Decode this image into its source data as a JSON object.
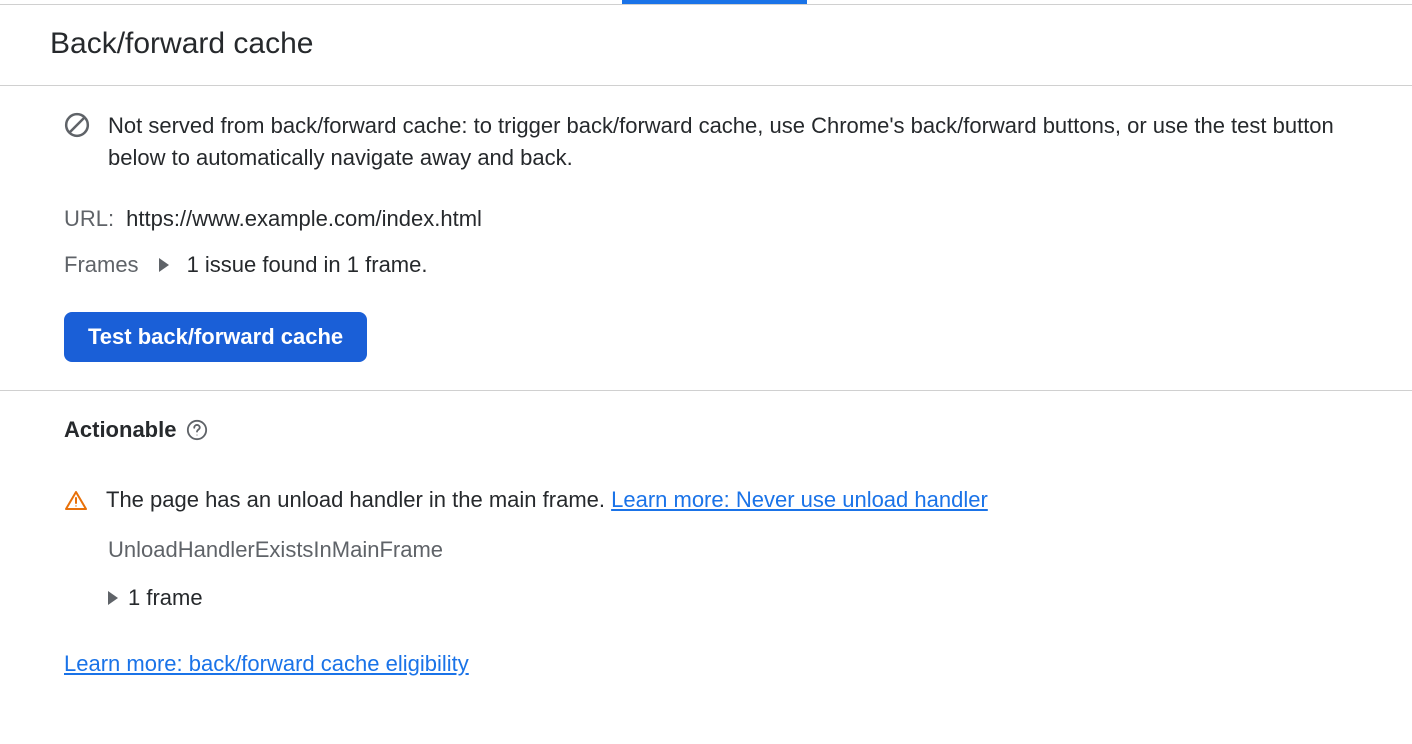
{
  "header": {
    "title": "Back/forward cache"
  },
  "info": {
    "message": "Not served from back/forward cache: to trigger back/forward cache, use Chrome's back/forward buttons, or use the test button below to automatically navigate away and back."
  },
  "url": {
    "label": "URL:",
    "value": "https://www.example.com/index.html"
  },
  "frames": {
    "label": "Frames",
    "summary": "1 issue found in 1 frame."
  },
  "buttons": {
    "test": "Test back/forward cache"
  },
  "actionable": {
    "title": "Actionable",
    "issue": {
      "text": "The page has an unload handler in the main frame. ",
      "link_label": "Learn more: Never use unload handler",
      "code": "UnloadHandlerExistsInMainFrame",
      "frame_count": "1 frame"
    },
    "footer_link": "Learn more: back/forward cache eligibility"
  }
}
